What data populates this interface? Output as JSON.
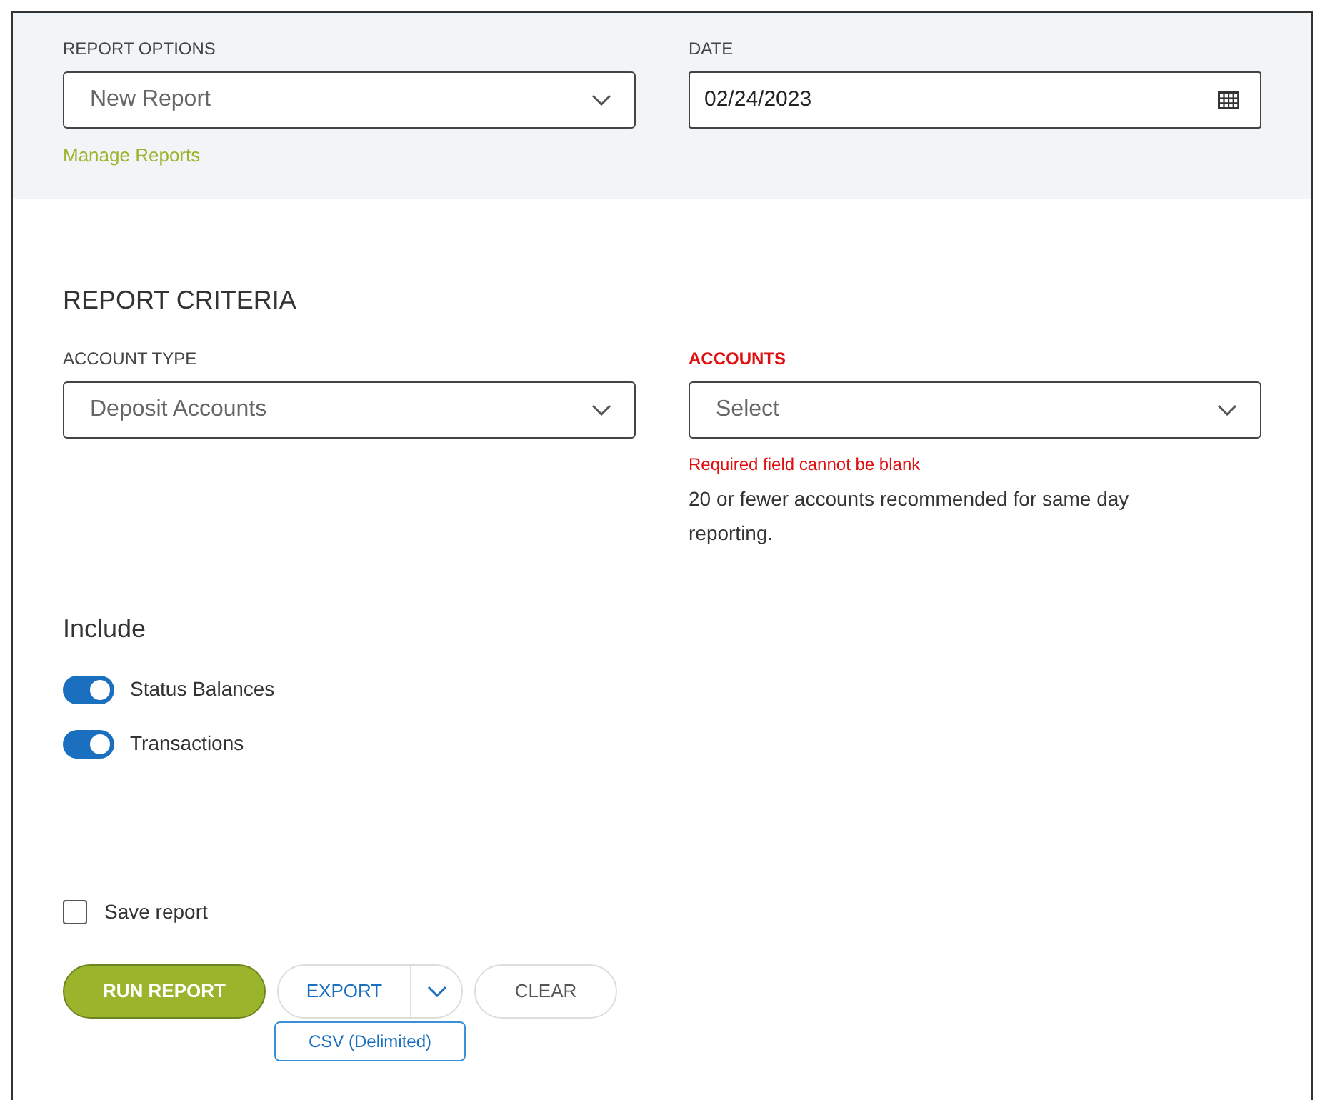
{
  "report_options": {
    "label": "REPORT OPTIONS",
    "value": "New Report",
    "link": "Manage Reports"
  },
  "date": {
    "label": "DATE",
    "value": "02/24/2023"
  },
  "criteria": {
    "title": "REPORT CRITERIA",
    "account_type": {
      "label": "ACCOUNT TYPE",
      "value": "Deposit Accounts"
    },
    "accounts": {
      "label": "ACCOUNTS",
      "placeholder": "Select",
      "error": "Required field cannot be blank",
      "hint": "20 or fewer accounts recommended for same day reporting."
    }
  },
  "include": {
    "title": "Include",
    "toggles": [
      {
        "label": "Status Balances",
        "on": true
      },
      {
        "label": "Transactions",
        "on": true
      }
    ]
  },
  "save_report": {
    "label": "Save report",
    "checked": false
  },
  "buttons": {
    "run": "RUN REPORT",
    "export": "EXPORT",
    "clear": "CLEAR",
    "export_option": "CSV (Delimited)"
  }
}
